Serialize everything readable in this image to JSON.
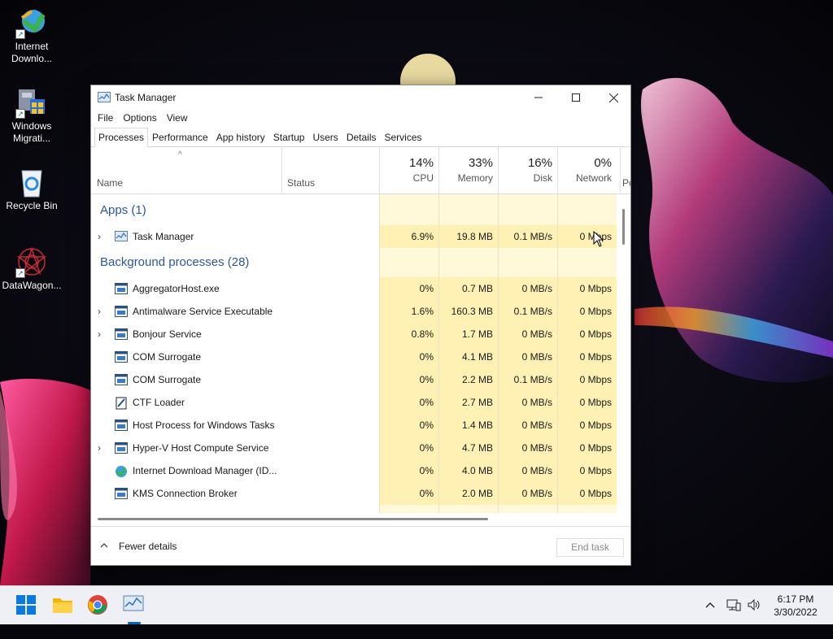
{
  "desktop": {
    "icons": [
      {
        "label": "Internet Downlo...",
        "icon": "internet-download-manager-icon"
      },
      {
        "label": "Windows Migrati...",
        "icon": "windows-migration-icon"
      },
      {
        "label": "Recycle Bin",
        "icon": "recycle-bin-icon"
      },
      {
        "label": "DataWagon...",
        "icon": "datawagon-icon"
      }
    ]
  },
  "window": {
    "title": "Task Manager",
    "menu": [
      "File",
      "Options",
      "View"
    ],
    "tabs": [
      "Processes",
      "Performance",
      "App history",
      "Startup",
      "Users",
      "Details",
      "Services"
    ],
    "active_tab": "Processes",
    "columns": {
      "name": "Name",
      "status": "Status",
      "cpu": {
        "pct": "14%",
        "label": "CPU"
      },
      "memory": {
        "pct": "33%",
        "label": "Memory"
      },
      "disk": {
        "pct": "16%",
        "label": "Disk"
      },
      "network": {
        "pct": "0%",
        "label": "Network"
      },
      "power": "Po"
    },
    "groups": {
      "apps": "Apps (1)",
      "background": "Background processes (28)"
    },
    "apps": [
      {
        "name": "Task Manager",
        "cpu": "6.9%",
        "memory": "19.8 MB",
        "disk": "0.1 MB/s",
        "network": "0 Mbps",
        "expandable": true,
        "icon": "task-manager-icon"
      }
    ],
    "background": [
      {
        "name": "AggregatorHost.exe",
        "cpu": "0%",
        "memory": "0.7 MB",
        "disk": "0 MB/s",
        "network": "0 Mbps",
        "expandable": false,
        "icon": "process-window-icon"
      },
      {
        "name": "Antimalware Service Executable",
        "cpu": "1.6%",
        "memory": "160.3 MB",
        "disk": "0.1 MB/s",
        "network": "0 Mbps",
        "expandable": true,
        "icon": "process-window-icon"
      },
      {
        "name": "Bonjour Service",
        "cpu": "0.8%",
        "memory": "1.7 MB",
        "disk": "0 MB/s",
        "network": "0 Mbps",
        "expandable": true,
        "icon": "process-window-icon"
      },
      {
        "name": "COM Surrogate",
        "cpu": "0%",
        "memory": "4.1 MB",
        "disk": "0 MB/s",
        "network": "0 Mbps",
        "expandable": false,
        "icon": "process-window-icon"
      },
      {
        "name": "COM Surrogate",
        "cpu": "0%",
        "memory": "2.2 MB",
        "disk": "0.1 MB/s",
        "network": "0 Mbps",
        "expandable": false,
        "icon": "process-window-icon"
      },
      {
        "name": "CTF Loader",
        "cpu": "0%",
        "memory": "2.7 MB",
        "disk": "0 MB/s",
        "network": "0 Mbps",
        "expandable": false,
        "icon": "ctf-loader-icon"
      },
      {
        "name": "Host Process for Windows Tasks",
        "cpu": "0%",
        "memory": "1.4 MB",
        "disk": "0 MB/s",
        "network": "0 Mbps",
        "expandable": false,
        "icon": "process-window-icon"
      },
      {
        "name": "Hyper-V Host Compute Service",
        "cpu": "0%",
        "memory": "4.7 MB",
        "disk": "0 MB/s",
        "network": "0 Mbps",
        "expandable": true,
        "icon": "process-window-icon"
      },
      {
        "name": "Internet Download Manager (ID...",
        "cpu": "0%",
        "memory": "4.0 MB",
        "disk": "0 MB/s",
        "network": "0 Mbps",
        "expandable": false,
        "icon": "internet-download-manager-icon"
      },
      {
        "name": "KMS Connection Broker",
        "cpu": "0%",
        "memory": "2.0 MB",
        "disk": "0 MB/s",
        "network": "0 Mbps",
        "expandable": false,
        "icon": "process-window-icon"
      }
    ],
    "footer": {
      "fewer_details": "Fewer details",
      "end_task": "End task"
    }
  },
  "taskbar": {
    "apps": [
      "windows-start-icon",
      "file-explorer-icon",
      "chrome-icon",
      "task-manager-icon"
    ],
    "tray": {
      "time": "6:17 PM",
      "date": "3/30/2022"
    }
  },
  "colors": {
    "group_text": "#2b579a",
    "heat_light": "#fff9d9",
    "heat_mid": "#fff1b3",
    "accent_blue": "#0067c0"
  }
}
